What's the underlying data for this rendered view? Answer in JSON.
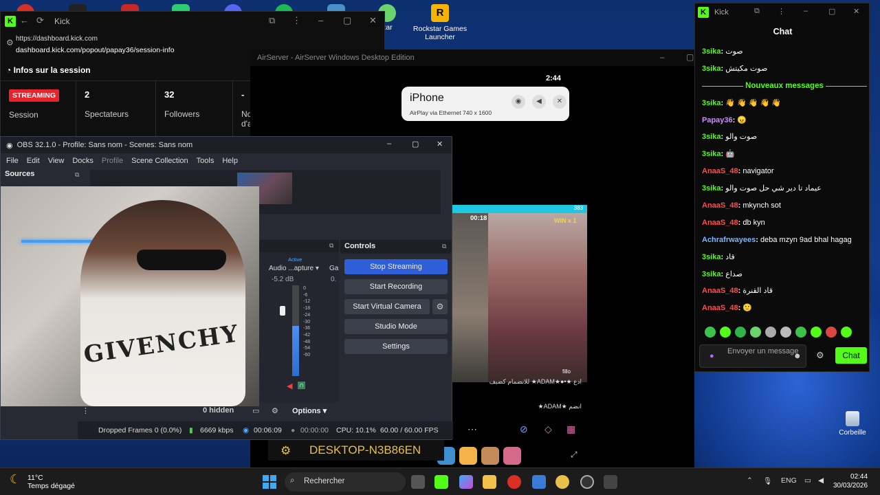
{
  "desktop": {
    "rockstar_label": "Rockstar Games Launcher",
    "recycle_label": "Corbeille",
    "partial_icon_label": "zar"
  },
  "kick_dashboard": {
    "title": "Kick",
    "url_host": "https://dashboard.kick.com",
    "url_path": "dashboard.kick.com/popout/papay36/session-info",
    "section_title": "Infos sur la session",
    "live_badge": "STREAMING",
    "session_label": "Session",
    "viewers_value": "2",
    "viewers_label": "Spectateurs",
    "followers_value": "32",
    "followers_label": "Followers",
    "fourth_value": "-",
    "fourth_label": "No d'a"
  },
  "airserver": {
    "title": "AirServer - AirServer Windows Desktop Edition",
    "phone_time": "2:44",
    "device_name": "iPhone",
    "device_sub": "AirPlay via Ethernet 740 x 1600",
    "timer": "00:18",
    "win_label": "WIN x 1",
    "live_count": "383",
    "viewer_name": "fillo",
    "comment_1": "ادع ★•●★ADAM★ للانضمام كضيف",
    "comment_2": "انضم ★ADAM★",
    "computer_name": "DESKTOP-N3B86EN"
  },
  "obs": {
    "title": "OBS 32.1.0 - Profile: Sans nom - Scenes: Sans nom",
    "menu": [
      "File",
      "Edit",
      "View",
      "Docks",
      "Profile",
      "Scene Collection",
      "Tools",
      "Help"
    ],
    "sources_label": "Sources",
    "mixer_active": "Active",
    "mixer_source": "Audio ...apture",
    "mixer_second": "Ga",
    "mixer_db": "-5.2 dB",
    "mixer_db2": "0.",
    "meter_level": 0.55,
    "scale": [
      "0",
      "-6",
      "-12",
      "-18",
      "-24",
      "-30",
      "-36",
      "-42",
      "-48",
      "-54",
      "-60"
    ],
    "controls_title": "Controls",
    "stop_streaming": "Stop Streaming",
    "start_recording": "Start Recording",
    "start_virtual_camera": "Start Virtual Camera",
    "studio_mode": "Studio Mode",
    "settings": "Settings",
    "hidden_label": "0 hidden",
    "options_label": "Options",
    "status_dropped": "Dropped Frames 0 (0.0%)",
    "status_kbps": "6669 kbps",
    "status_stream_time": "00:06:09",
    "status_rec_time": "00:00:00",
    "status_cpu": "CPU: 10.1%",
    "status_fps": "60.00 / 60.00 FPS",
    "shirt_text": "GIVENCHY"
  },
  "chat": {
    "window_title": "Kick",
    "title": "Chat",
    "new_messages": "Nouveaux messages",
    "messages_before": [
      {
        "user": "3sika",
        "text": "صوت",
        "color": "#53fc18"
      },
      {
        "user": "3sika",
        "text": "صوت مكيتش",
        "color": "#53fc18"
      }
    ],
    "messages_after": [
      {
        "user": "3sika",
        "text": "👋 👋 👋 👋 👋",
        "color": "#53fc18"
      },
      {
        "user": "Papay36",
        "text": "😠",
        "color": "#c98cff"
      },
      {
        "user": "3sika",
        "text": "صوت والو",
        "color": "#53fc18"
      },
      {
        "user": "3sika",
        "text": "🤖",
        "color": "#53fc18"
      },
      {
        "user": "AnaaS_48",
        "text": "navigator",
        "color": "#ff4d4d"
      },
      {
        "user": "3sika",
        "text": "عيماد تا دير شي حل صوت والو",
        "color": "#53fc18"
      },
      {
        "user": "AnaaS_48",
        "text": "mkynch sot",
        "color": "#ff4d4d"
      },
      {
        "user": "AnaaS_48",
        "text": "db kyn",
        "color": "#ff4d4d"
      },
      {
        "user": "Achrafrwayees",
        "text": "deba mzyn 9ad bhal hagag",
        "color": "#7fb4ff"
      },
      {
        "user": "3sika",
        "text": "قاد",
        "color": "#53fc18"
      },
      {
        "user": "3sika",
        "text": "صداع",
        "color": "#53fc18"
      },
      {
        "user": "AnaaS_48",
        "text": "قاد القنرة",
        "color": "#ff4d4d"
      },
      {
        "user": "AnaaS_48",
        "text": "🙂",
        "color": "#ff4d4d"
      }
    ],
    "input_placeholder": "Envoyer un message",
    "send_label": "Chat"
  },
  "taskbar": {
    "temperature": "11°C",
    "weather": "Temps dégagé",
    "search": "Rechercher",
    "language": "ENG",
    "time": "02:44",
    "date": "30/03/2026"
  }
}
